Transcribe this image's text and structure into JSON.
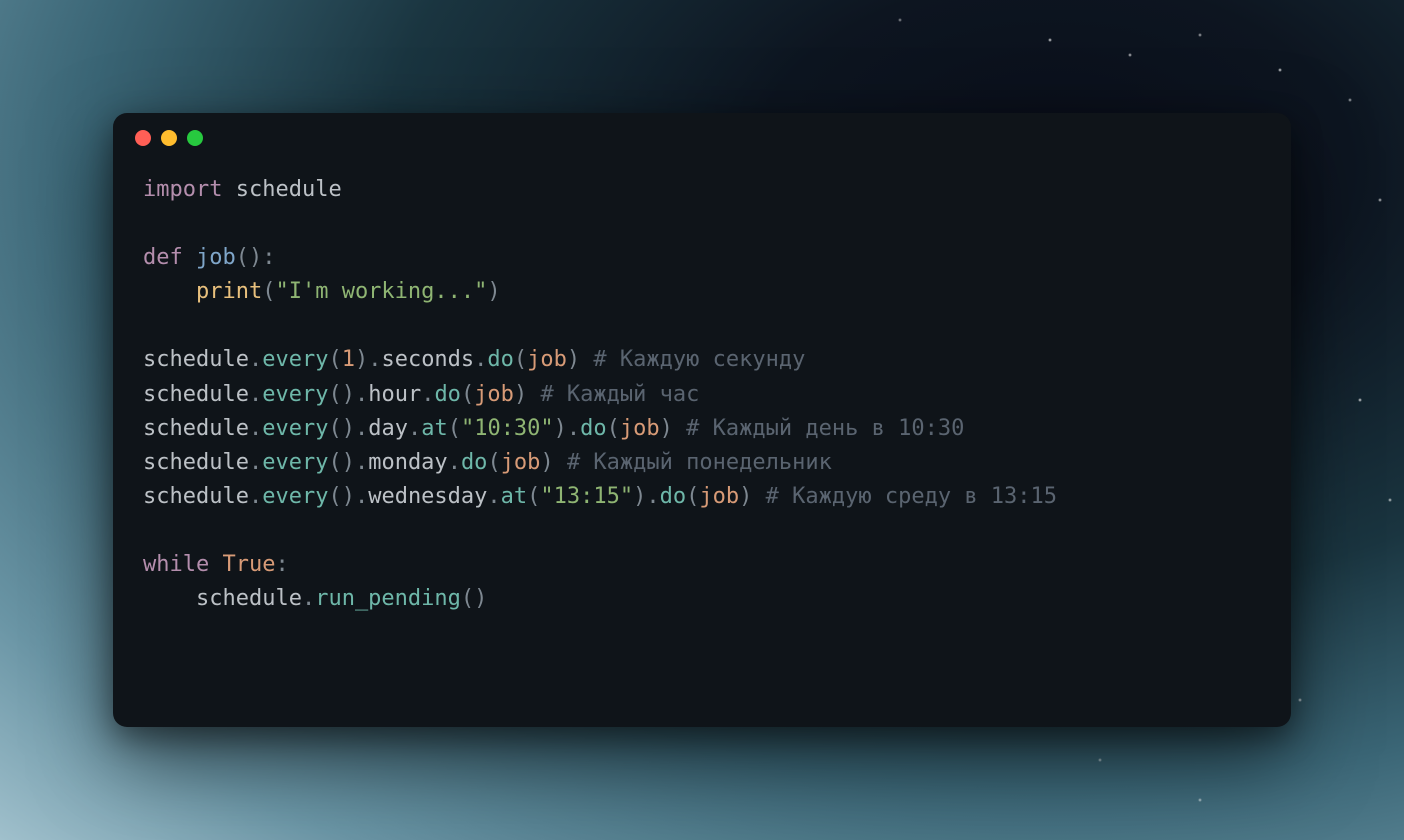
{
  "theme": {
    "window_bg": "#0f1419",
    "keyword": "#b48ead",
    "def_name": "#7fa6c9",
    "identifier": "#bcc1c6",
    "punct": "#7e8891",
    "call": "#6eb7a9",
    "builtin": "#e8c07d",
    "param": "#d89b77",
    "number": "#d89b77",
    "string": "#8fb573",
    "const": "#d89b77",
    "comment": "#5a6470"
  },
  "traffic_lights": {
    "red": "#ff5f56",
    "yellow": "#ffbd2e",
    "green": "#27c93f"
  },
  "code": {
    "language": "python",
    "lines": [
      [
        {
          "t": "keyword",
          "v": "import"
        },
        {
          "t": "space",
          "v": " "
        },
        {
          "t": "ident",
          "v": "schedule"
        }
      ],
      [],
      [
        {
          "t": "keyword",
          "v": "def"
        },
        {
          "t": "space",
          "v": " "
        },
        {
          "t": "deffn",
          "v": "job"
        },
        {
          "t": "punct",
          "v": "("
        },
        {
          "t": "punct",
          "v": ")"
        },
        {
          "t": "punct",
          "v": ":"
        }
      ],
      [
        {
          "t": "space",
          "v": "    "
        },
        {
          "t": "builtin",
          "v": "print"
        },
        {
          "t": "punct",
          "v": "("
        },
        {
          "t": "string",
          "v": "\"I'm working...\""
        },
        {
          "t": "punct",
          "v": ")"
        }
      ],
      [],
      [
        {
          "t": "ident",
          "v": "schedule"
        },
        {
          "t": "punct",
          "v": "."
        },
        {
          "t": "call",
          "v": "every"
        },
        {
          "t": "punct",
          "v": "("
        },
        {
          "t": "number",
          "v": "1"
        },
        {
          "t": "punct",
          "v": ")"
        },
        {
          "t": "punct",
          "v": "."
        },
        {
          "t": "ident",
          "v": "seconds"
        },
        {
          "t": "punct",
          "v": "."
        },
        {
          "t": "call",
          "v": "do"
        },
        {
          "t": "punct",
          "v": "("
        },
        {
          "t": "param",
          "v": "job"
        },
        {
          "t": "punct",
          "v": ")"
        },
        {
          "t": "space",
          "v": " "
        },
        {
          "t": "comment",
          "v": "# Каждую секунду"
        }
      ],
      [
        {
          "t": "ident",
          "v": "schedule"
        },
        {
          "t": "punct",
          "v": "."
        },
        {
          "t": "call",
          "v": "every"
        },
        {
          "t": "punct",
          "v": "("
        },
        {
          "t": "punct",
          "v": ")"
        },
        {
          "t": "punct",
          "v": "."
        },
        {
          "t": "ident",
          "v": "hour"
        },
        {
          "t": "punct",
          "v": "."
        },
        {
          "t": "call",
          "v": "do"
        },
        {
          "t": "punct",
          "v": "("
        },
        {
          "t": "param",
          "v": "job"
        },
        {
          "t": "punct",
          "v": ")"
        },
        {
          "t": "space",
          "v": " "
        },
        {
          "t": "comment",
          "v": "# Каждый час"
        }
      ],
      [
        {
          "t": "ident",
          "v": "schedule"
        },
        {
          "t": "punct",
          "v": "."
        },
        {
          "t": "call",
          "v": "every"
        },
        {
          "t": "punct",
          "v": "("
        },
        {
          "t": "punct",
          "v": ")"
        },
        {
          "t": "punct",
          "v": "."
        },
        {
          "t": "ident",
          "v": "day"
        },
        {
          "t": "punct",
          "v": "."
        },
        {
          "t": "call",
          "v": "at"
        },
        {
          "t": "punct",
          "v": "("
        },
        {
          "t": "string",
          "v": "\"10:30\""
        },
        {
          "t": "punct",
          "v": ")"
        },
        {
          "t": "punct",
          "v": "."
        },
        {
          "t": "call",
          "v": "do"
        },
        {
          "t": "punct",
          "v": "("
        },
        {
          "t": "param",
          "v": "job"
        },
        {
          "t": "punct",
          "v": ")"
        },
        {
          "t": "space",
          "v": " "
        },
        {
          "t": "comment",
          "v": "# Каждый день в 10:30"
        }
      ],
      [
        {
          "t": "ident",
          "v": "schedule"
        },
        {
          "t": "punct",
          "v": "."
        },
        {
          "t": "call",
          "v": "every"
        },
        {
          "t": "punct",
          "v": "("
        },
        {
          "t": "punct",
          "v": ")"
        },
        {
          "t": "punct",
          "v": "."
        },
        {
          "t": "ident",
          "v": "monday"
        },
        {
          "t": "punct",
          "v": "."
        },
        {
          "t": "call",
          "v": "do"
        },
        {
          "t": "punct",
          "v": "("
        },
        {
          "t": "param",
          "v": "job"
        },
        {
          "t": "punct",
          "v": ")"
        },
        {
          "t": "space",
          "v": " "
        },
        {
          "t": "comment",
          "v": "# Каждый понедельник"
        }
      ],
      [
        {
          "t": "ident",
          "v": "schedule"
        },
        {
          "t": "punct",
          "v": "."
        },
        {
          "t": "call",
          "v": "every"
        },
        {
          "t": "punct",
          "v": "("
        },
        {
          "t": "punct",
          "v": ")"
        },
        {
          "t": "punct",
          "v": "."
        },
        {
          "t": "ident",
          "v": "wednesday"
        },
        {
          "t": "punct",
          "v": "."
        },
        {
          "t": "call",
          "v": "at"
        },
        {
          "t": "punct",
          "v": "("
        },
        {
          "t": "string",
          "v": "\"13:15\""
        },
        {
          "t": "punct",
          "v": ")"
        },
        {
          "t": "punct",
          "v": "."
        },
        {
          "t": "call",
          "v": "do"
        },
        {
          "t": "punct",
          "v": "("
        },
        {
          "t": "param",
          "v": "job"
        },
        {
          "t": "punct",
          "v": ")"
        },
        {
          "t": "space",
          "v": " "
        },
        {
          "t": "comment",
          "v": "# Каждую среду в 13:15"
        }
      ],
      [],
      [
        {
          "t": "keyword",
          "v": "while"
        },
        {
          "t": "space",
          "v": " "
        },
        {
          "t": "const",
          "v": "True"
        },
        {
          "t": "punct",
          "v": ":"
        }
      ],
      [
        {
          "t": "space",
          "v": "    "
        },
        {
          "t": "ident",
          "v": "schedule"
        },
        {
          "t": "punct",
          "v": "."
        },
        {
          "t": "call",
          "v": "run_pending"
        },
        {
          "t": "punct",
          "v": "("
        },
        {
          "t": "punct",
          "v": ")"
        }
      ]
    ]
  }
}
